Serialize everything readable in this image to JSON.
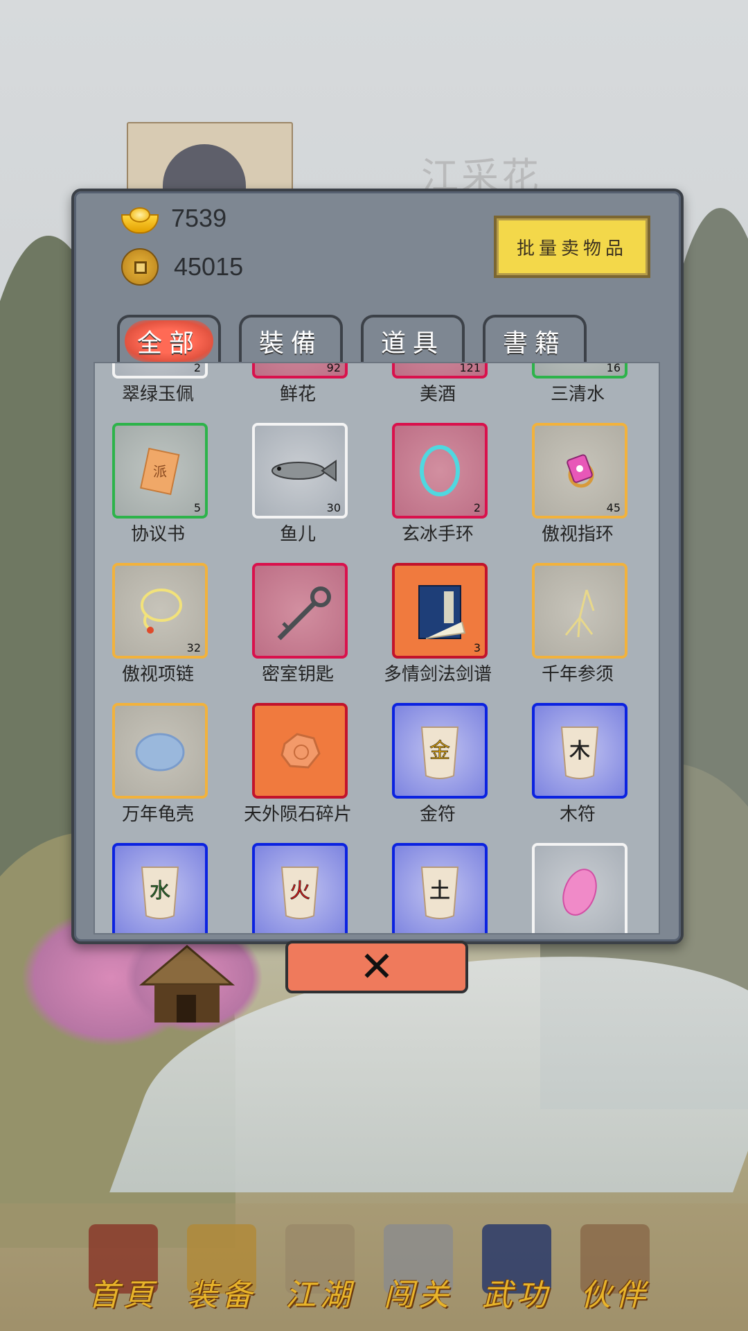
{
  "npc": {
    "name": "江采花"
  },
  "currency": {
    "ingots": "7539",
    "coins": "45015"
  },
  "sell_button_label": "批量卖物品",
  "tabs": [
    {
      "label": "全部",
      "active": true
    },
    {
      "label": "裝備",
      "active": false
    },
    {
      "label": "道具",
      "active": false
    },
    {
      "label": "書籍",
      "active": false
    }
  ],
  "items": [
    {
      "name": "翠绿玉佩",
      "count": "2",
      "rarity": "white",
      "icon": "jade-pendant-icon"
    },
    {
      "name": "鲜花",
      "count": "92",
      "rarity": "red",
      "icon": "flower-icon"
    },
    {
      "name": "美酒",
      "count": "121",
      "rarity": "red",
      "icon": "wine-icon"
    },
    {
      "name": "三清水",
      "count": "16",
      "rarity": "green",
      "icon": "water-icon"
    },
    {
      "name": "协议书",
      "count": "5",
      "rarity": "green",
      "icon": "agreement-icon",
      "glyph": "派"
    },
    {
      "name": "鱼儿",
      "count": "30",
      "rarity": "white",
      "icon": "fish-icon"
    },
    {
      "name": "玄冰手环",
      "count": "2",
      "rarity": "red",
      "icon": "bracelet-icon"
    },
    {
      "name": "傲视指环",
      "count": "45",
      "rarity": "gold",
      "icon": "ring-icon"
    },
    {
      "name": "傲视项链",
      "count": "32",
      "rarity": "gold",
      "icon": "necklace-icon"
    },
    {
      "name": "密室钥匙",
      "count": "",
      "rarity": "red",
      "icon": "key-icon"
    },
    {
      "name": "多情剑法剑谱",
      "count": "3",
      "rarity": "orange",
      "icon": "book-icon"
    },
    {
      "name": "千年参须",
      "count": "",
      "rarity": "gold",
      "icon": "ginseng-icon"
    },
    {
      "name": "万年龟壳",
      "count": "",
      "rarity": "gold",
      "icon": "turtle-shell-icon"
    },
    {
      "name": "天外陨石碎片",
      "count": "",
      "rarity": "orange",
      "icon": "meteorite-icon"
    },
    {
      "name": "金符",
      "count": "",
      "rarity": "blue",
      "icon": "talisman-icon",
      "glyph": "金"
    },
    {
      "name": "木符",
      "count": "",
      "rarity": "blue",
      "icon": "talisman-icon",
      "glyph": "木"
    },
    {
      "name": "",
      "count": "",
      "rarity": "blue",
      "icon": "talisman-icon",
      "glyph": "水"
    },
    {
      "name": "",
      "count": "",
      "rarity": "blue",
      "icon": "talisman-icon",
      "glyph": "火"
    },
    {
      "name": "",
      "count": "",
      "rarity": "blue",
      "icon": "talisman-icon",
      "glyph": "土"
    },
    {
      "name": "",
      "count": "",
      "rarity": "white",
      "icon": "pink-gem-icon"
    }
  ],
  "close_icon": "close-icon",
  "nav": [
    {
      "label": "首頁",
      "icon": "home-icon"
    },
    {
      "label": "装备",
      "icon": "armor-icon"
    },
    {
      "label": "江湖",
      "icon": "scroll-icon"
    },
    {
      "label": "闯关",
      "icon": "swords-icon"
    },
    {
      "label": "武功",
      "icon": "manual-icon"
    },
    {
      "label": "伙伴",
      "icon": "partners-icon"
    }
  ],
  "colors": {
    "panel": "#7e8792",
    "sell_button": "#f3d84a",
    "close_button": "#ef7a5c",
    "rarity_white": "#f4f4f4",
    "rarity_green": "#2db34a",
    "rarity_gold": "#f2b23c",
    "rarity_red": "#d9114c",
    "rarity_blue": "#0b22e0",
    "rarity_orange": "#c2132b"
  }
}
